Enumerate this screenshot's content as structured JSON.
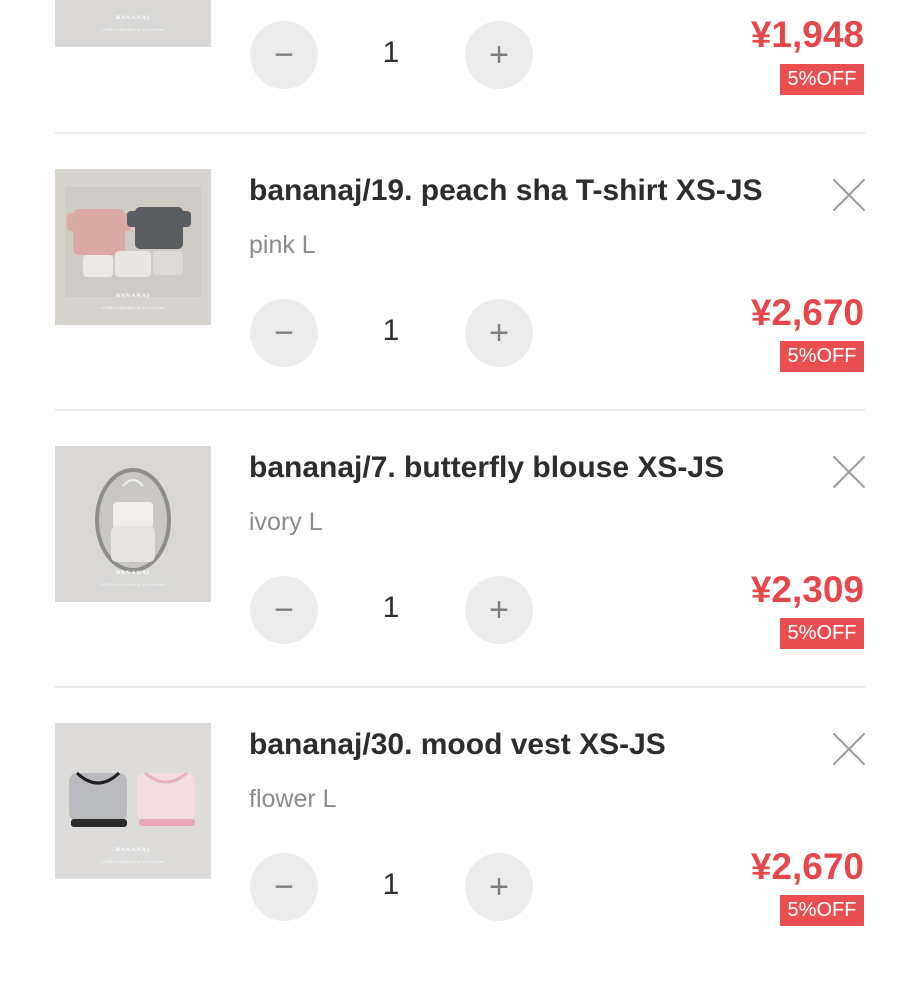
{
  "cart": {
    "items": [
      {
        "title": "",
        "option": "",
        "quantity": "1",
        "price": "¥1,948",
        "discount": "5%OFF",
        "brand_mark": "BANANAJ",
        "brand_sub": "a little collection of knit thread"
      },
      {
        "title": "bananaj/19. peach sha T-shirt XS-JS",
        "option": "pink L",
        "quantity": "1",
        "price": "¥2,670",
        "discount": "5%OFF",
        "brand_mark": "BANANAJ",
        "brand_sub": "a little collection of knit thread"
      },
      {
        "title": "bananaj/7. butterfly blouse XS-JS",
        "option": "ivory L",
        "quantity": "1",
        "price": "¥2,309",
        "discount": "5%OFF",
        "brand_mark": "BANANAJ",
        "brand_sub": "a little collection of knit thread"
      },
      {
        "title": "bananaj/30. mood vest XS-JS",
        "option": "flower L",
        "quantity": "1",
        "price": "¥2,670",
        "discount": "5%OFF",
        "brand_mark": "BANANAJ",
        "brand_sub": "a little collection of knit thread"
      }
    ],
    "controls": {
      "minus_symbol": "−",
      "plus_symbol": "+",
      "remove_icon": "close-icon"
    },
    "colors": {
      "price": "#e5474a",
      "badge_bg": "#e94f50",
      "stepper_bg": "#ececec",
      "divider": "#e9e9e9"
    }
  }
}
